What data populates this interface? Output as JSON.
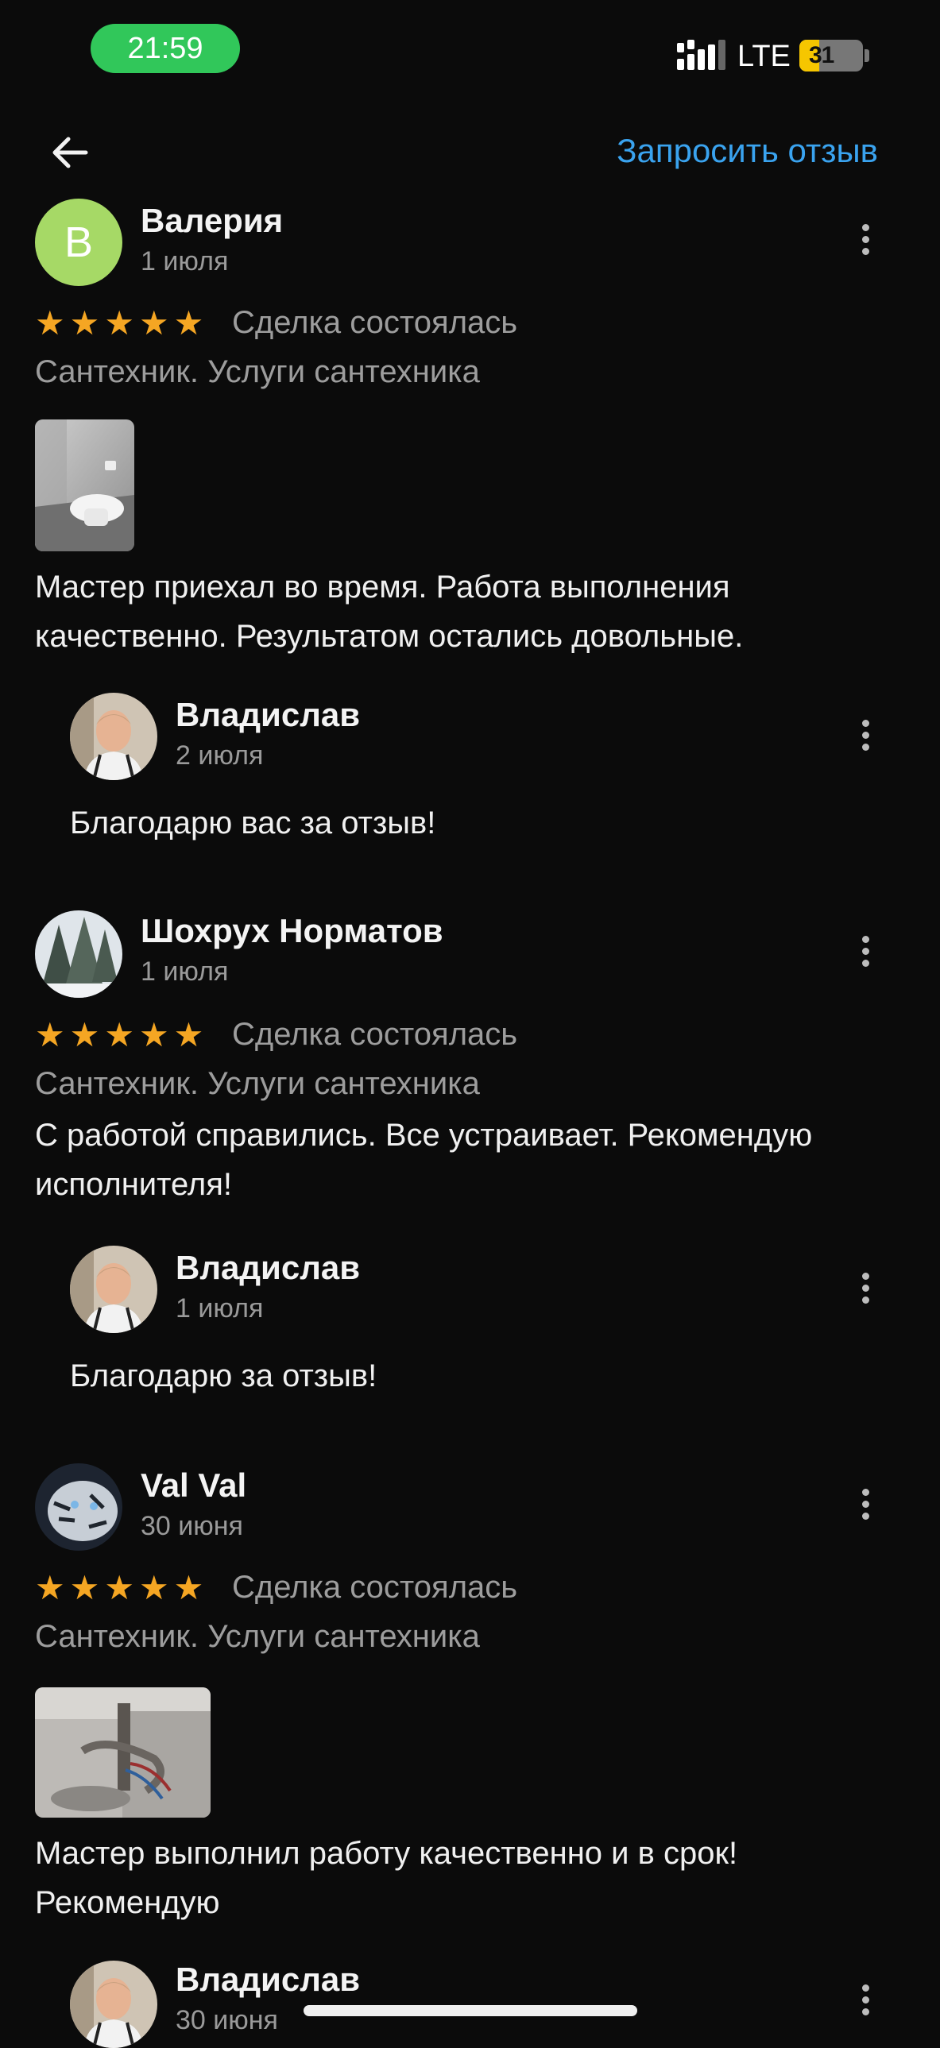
{
  "status_bar": {
    "time": "21:59",
    "network": "LTE",
    "battery_level": "31",
    "battery_fraction": 0.31,
    "colors": {
      "time_pill": "#31c75a",
      "battery": "#f6c600"
    }
  },
  "header": {
    "back_icon": "arrow-left-icon",
    "request_review_label": "Запросить отзыв",
    "accent_color": "#3aa3ef"
  },
  "reviews": [
    {
      "author": "Валерия",
      "avatar_letter": "В",
      "date": "1 июля",
      "rating": 5,
      "deal_status": "Сделка состоялась",
      "category": "Сантехник. Услуги сантехника",
      "text": "Мастер приехал во время. Работа выполнения качественно.  Результатом остались довольные.",
      "reply": {
        "author": "Владислав",
        "date": "2 июля",
        "text": "Благодарю вас за отзыв!"
      }
    },
    {
      "author": "Шохрух Норматов",
      "date": "1 июля",
      "rating": 5,
      "deal_status": "Сделка состоялась",
      "category": "Сантехник. Услуги сантехника",
      "text": "С работой справились. Все устраивает. Рекомендую исполнителя!",
      "reply": {
        "author": "Владислав",
        "date": "1 июля",
        "text": "Благодарю за отзыв!"
      }
    },
    {
      "author": "Val Val",
      "date": "30 июня",
      "rating": 5,
      "deal_status": "Сделка состоялась",
      "category": "Сантехник. Услуги сантехника",
      "text": "Мастер выполнил работу качественно и в срок! Рекомендую",
      "reply": {
        "author": "Владислав",
        "date": "30 июня"
      }
    }
  ],
  "star_color": "#f5a623"
}
